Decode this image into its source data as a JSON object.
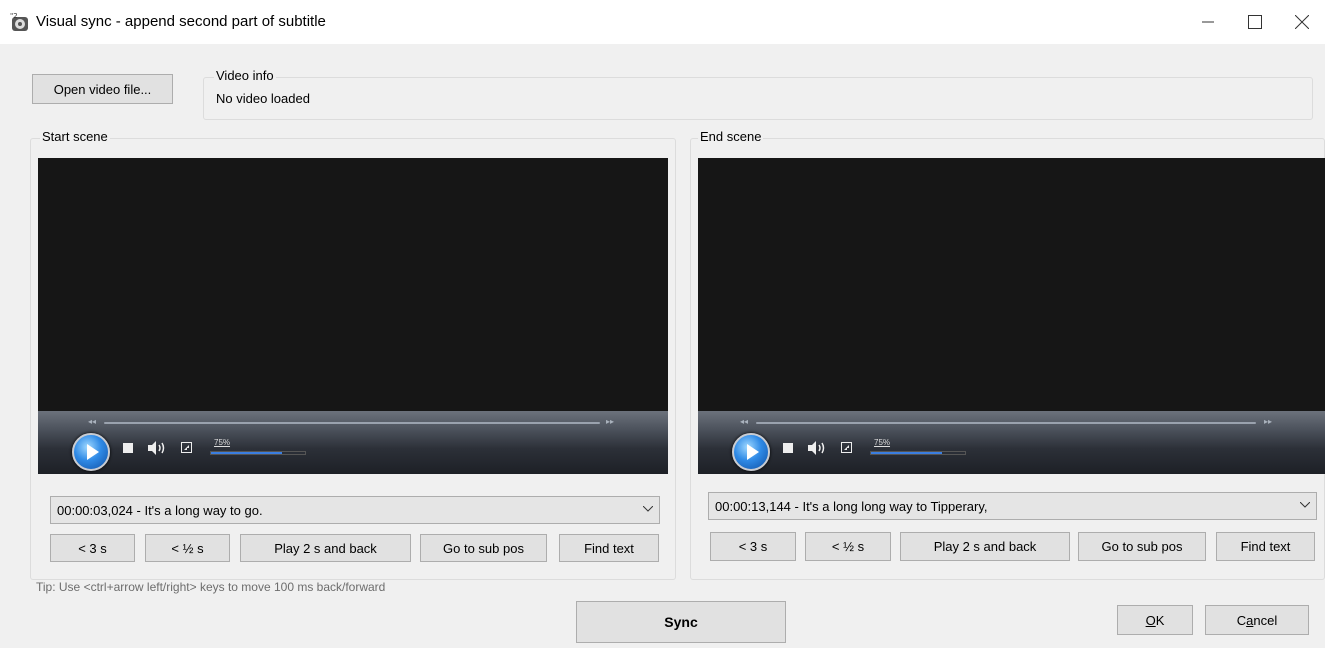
{
  "window": {
    "title": "Visual sync - append second part of subtitle",
    "minimize_icon": "minimize-icon",
    "maximize_icon": "maximize-icon",
    "close_icon": "close-icon",
    "app_icon": "subtitle-edit-app-icon"
  },
  "top": {
    "open_video_label": "Open video file...",
    "video_info_title": "Video info",
    "video_info_text": "No video loaded"
  },
  "start_scene": {
    "title": "Start scene",
    "volume_label": "75%",
    "volume_percent": 75,
    "selected_subtitle": "00:00:03,024 - It's a long way to go.",
    "buttons": {
      "back3": "< 3 s",
      "back_half": "< ½ s",
      "play2": "Play 2 s and back",
      "goto": "Go to sub pos",
      "find": "Find text"
    }
  },
  "end_scene": {
    "title": "End scene",
    "volume_label": "75%",
    "volume_percent": 75,
    "selected_subtitle": "00:00:13,144 - It's a long long way to Tipperary,",
    "buttons": {
      "back3": "< 3 s",
      "back_half": "< ½ s",
      "play2": "Play 2 s and back",
      "goto": "Go to sub pos",
      "find": "Find text"
    }
  },
  "bottom": {
    "tip": "Tip: Use <ctrl+arrow left/right> keys to move 100 ms back/forward",
    "sync_label": "Sync",
    "ok_label_accel": "O",
    "ok_label_rest": "K",
    "cancel_label_pre": "C",
    "cancel_label_accel": "a",
    "cancel_label_post": "ncel"
  },
  "colors": {
    "accent": "#0078d7",
    "video_bg": "#161616",
    "play_button": "#2f8ae6",
    "volume_fill": "#3b7ee0"
  }
}
